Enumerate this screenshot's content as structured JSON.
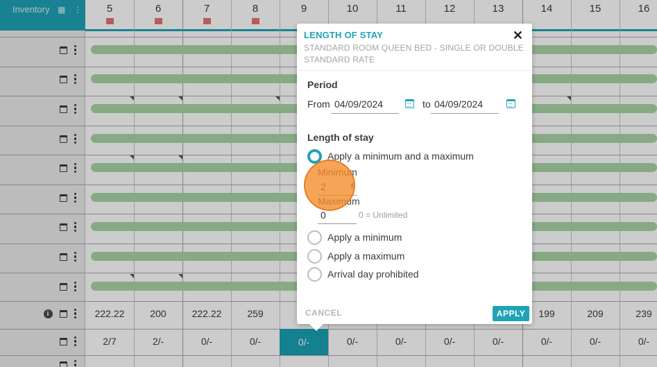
{
  "header": {
    "days": [
      "5",
      "6",
      "7",
      "8",
      "9",
      "10",
      "11",
      "12",
      "13",
      "14",
      "15",
      "16"
    ]
  },
  "left_panel": {
    "inventory_label": "Inventory"
  },
  "price_row": {
    "values": [
      "222.22",
      "200",
      "222.22",
      "259",
      "",
      "",
      "",
      "",
      "",
      "199",
      "209",
      "239"
    ]
  },
  "availability_row": {
    "values": [
      "2/7",
      "2/-",
      "0/-",
      "0/-",
      "0/-",
      "0/-",
      "0/-",
      "0/-",
      "0/-",
      "0/-",
      "0/-",
      "0/-"
    ]
  },
  "dialog": {
    "title": "LENGTH OF STAY",
    "subtitle_line1": "STANDARD ROOM QUEEN BED - SINGLE OR DOUBLE",
    "subtitle_line2": "STANDARD RATE",
    "close_symbol": "✕",
    "period": {
      "heading": "Period",
      "from_label": "From",
      "from_value": "04/09/2024",
      "to_label": "to",
      "to_value": "04/09/2024"
    },
    "length_of_stay": {
      "heading": "Length of stay",
      "options": [
        {
          "label": "Apply a minimum and a maximum",
          "checked": true
        },
        {
          "label": "Apply a minimum",
          "checked": false
        },
        {
          "label": "Apply a maximum",
          "checked": false
        },
        {
          "label": "Arrival day prohibited",
          "checked": false
        }
      ],
      "minimum_label": "Minimum",
      "minimum_value": "2",
      "maximum_label": "Maximum",
      "maximum_value": "0",
      "maximum_hint": "0 = Unlimited"
    },
    "cancel_label": "CANCEL",
    "apply_label": "APPLY"
  },
  "colors": {
    "accent": "#1fa3b7",
    "bar": "#a9d5a6",
    "restriction_mark": "#e57373",
    "click_marker": "#f58a28"
  }
}
